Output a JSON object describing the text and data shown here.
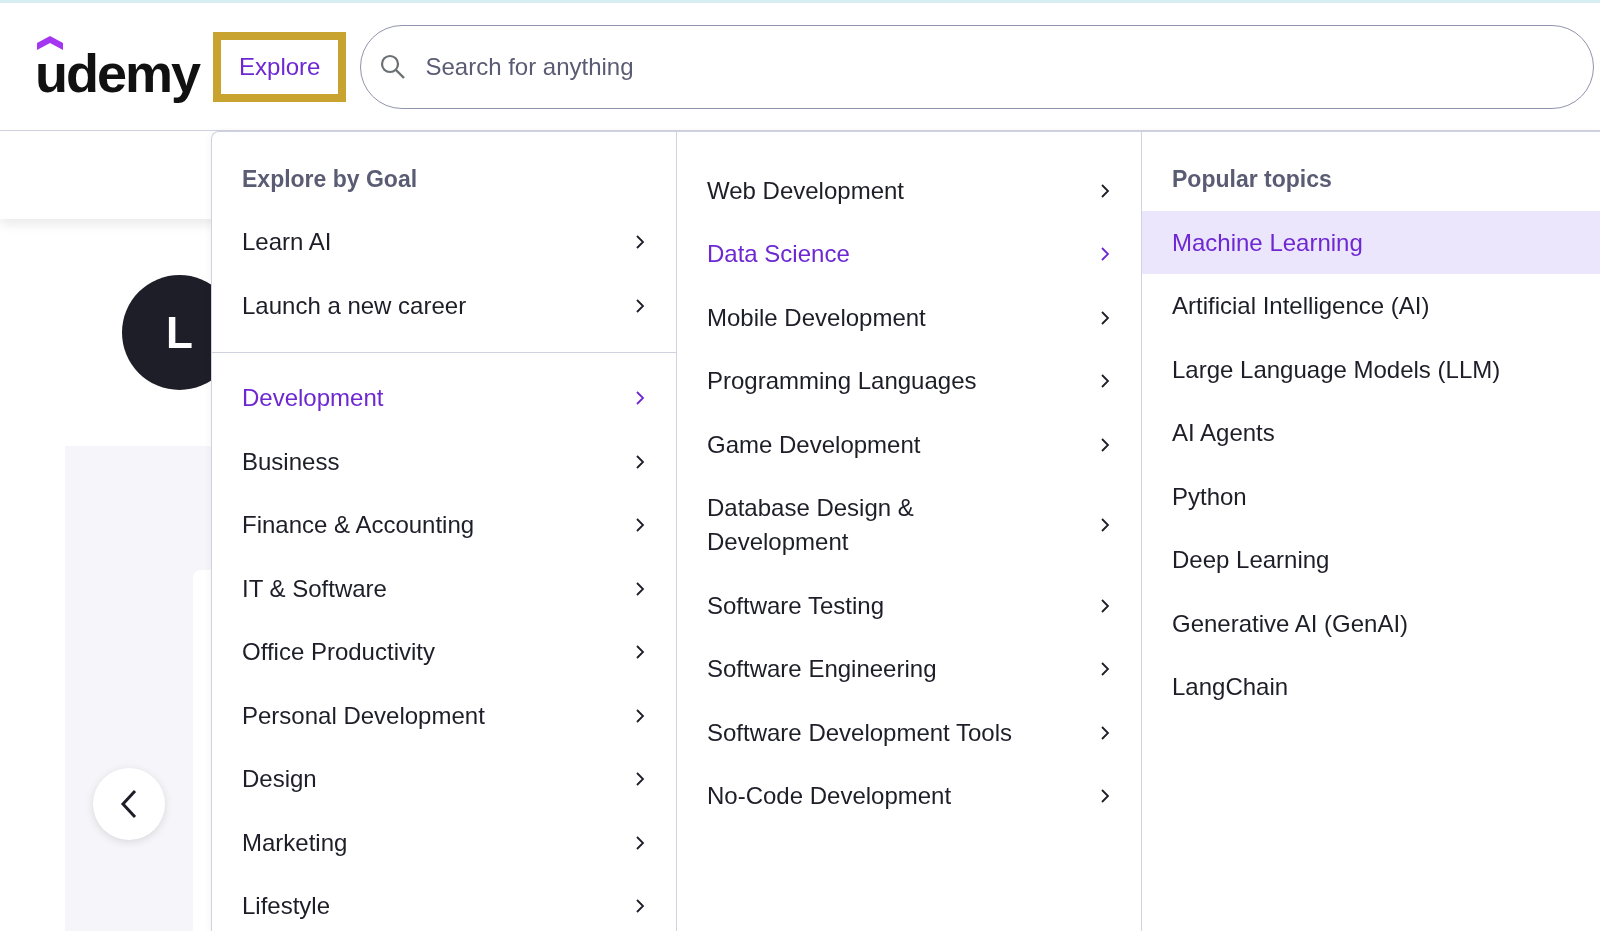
{
  "header": {
    "logo": "udemy",
    "explore_button": {
      "label": "Explore",
      "highlighted": true
    },
    "search": {
      "placeholder": "Search for anything"
    }
  },
  "page": {
    "avatar_initial": "L"
  },
  "menu": {
    "goal_heading": "Explore by Goal",
    "goals": [
      {
        "label": "Learn AI",
        "selected": false
      },
      {
        "label": "Launch a new career",
        "selected": false
      }
    ],
    "categories": [
      {
        "label": "Development",
        "selected": true
      },
      {
        "label": "Business",
        "selected": false
      },
      {
        "label": "Finance & Accounting",
        "selected": false
      },
      {
        "label": "IT & Software",
        "selected": false
      },
      {
        "label": "Office Productivity",
        "selected": false
      },
      {
        "label": "Personal Development",
        "selected": false
      },
      {
        "label": "Design",
        "selected": false
      },
      {
        "label": "Marketing",
        "selected": false
      },
      {
        "label": "Lifestyle",
        "selected": false
      }
    ],
    "subcategories": [
      {
        "label": "Web Development",
        "selected": false
      },
      {
        "label": "Data Science",
        "selected": true
      },
      {
        "label": "Mobile Development",
        "selected": false
      },
      {
        "label": "Programming Languages",
        "selected": false
      },
      {
        "label": "Game Development",
        "selected": false
      },
      {
        "label": "Database Design & Development",
        "selected": false
      },
      {
        "label": "Software Testing",
        "selected": false
      },
      {
        "label": "Software Engineering",
        "selected": false
      },
      {
        "label": "Software Development Tools",
        "selected": false
      },
      {
        "label": "No-Code Development",
        "selected": false
      }
    ],
    "topics_heading": "Popular topics",
    "topics": [
      {
        "label": "Machine Learning",
        "selected": true
      },
      {
        "label": "Artificial Intelligence (AI)",
        "selected": false
      },
      {
        "label": "Large Language Models (LLM)",
        "selected": false
      },
      {
        "label": "AI Agents",
        "selected": false
      },
      {
        "label": "Python",
        "selected": false
      },
      {
        "label": "Deep Learning",
        "selected": false
      },
      {
        "label": "Generative AI (GenAI)",
        "selected": false
      },
      {
        "label": "LangChain",
        "selected": false
      }
    ]
  }
}
